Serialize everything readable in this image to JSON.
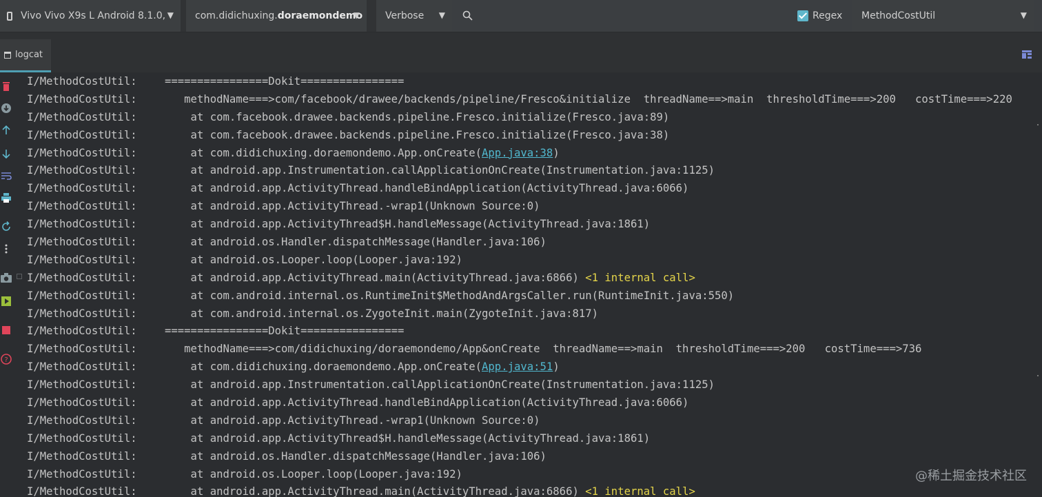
{
  "toolbar": {
    "device": "Vivo Vivo X9s L Android 8.1.0,",
    "process_prefix": "com.didichuxing.",
    "process_bold": "doraemondemo",
    "log_level": "Verbose",
    "regex_label": "Regex",
    "filter_value": "MethodCostUtil"
  },
  "tab": {
    "label": "logcat"
  },
  "log_lines": [
    {
      "tag": "I/MethodCostUtil:",
      "msg": "================Dokit================"
    },
    {
      "tag": "I/MethodCostUtil:",
      "msg": "   methodName===>com/facebook/drawee/backends/pipeline/Fresco&initialize  threadName==>main  thresholdTime===>200   costTime===>220"
    },
    {
      "tag": "I/MethodCostUtil:",
      "msg": "    at com.facebook.drawee.backends.pipeline.Fresco.initialize(Fresco.java:89)"
    },
    {
      "tag": "I/MethodCostUtil:",
      "msg": "    at com.facebook.drawee.backends.pipeline.Fresco.initialize(Fresco.java:38)"
    },
    {
      "tag": "I/MethodCostUtil:",
      "msg": "    at com.didichuxing.doraemondemo.App.onCreate(",
      "link": "App.java:38",
      "after": ")"
    },
    {
      "tag": "I/MethodCostUtil:",
      "msg": "    at android.app.Instrumentation.callApplicationOnCreate(Instrumentation.java:1125)"
    },
    {
      "tag": "I/MethodCostUtil:",
      "msg": "    at android.app.ActivityThread.handleBindApplication(ActivityThread.java:6066)"
    },
    {
      "tag": "I/MethodCostUtil:",
      "msg": "    at android.app.ActivityThread.-wrap1(Unknown Source:0)"
    },
    {
      "tag": "I/MethodCostUtil:",
      "msg": "    at android.app.ActivityThread$H.handleMessage(ActivityThread.java:1861)"
    },
    {
      "tag": "I/MethodCostUtil:",
      "msg": "    at android.os.Handler.dispatchMessage(Handler.java:106)"
    },
    {
      "tag": "I/MethodCostUtil:",
      "msg": "    at android.os.Looper.loop(Looper.java:192)"
    },
    {
      "tag": "I/MethodCostUtil:",
      "msg": "    at android.app.ActivityThread.main(ActivityThread.java:6866) ",
      "hint": "<1 internal call>"
    },
    {
      "tag": "I/MethodCostUtil:",
      "msg": "    at com.android.internal.os.RuntimeInit$MethodAndArgsCaller.run(RuntimeInit.java:550)"
    },
    {
      "tag": "I/MethodCostUtil:",
      "msg": "    at com.android.internal.os.ZygoteInit.main(ZygoteInit.java:817)"
    },
    {
      "tag": "I/MethodCostUtil:",
      "msg": "================Dokit================"
    },
    {
      "tag": "I/MethodCostUtil:",
      "msg": "   methodName===>com/didichuxing/doraemondemo/App&onCreate  threadName==>main  thresholdTime===>200   costTime===>736"
    },
    {
      "tag": "I/MethodCostUtil:",
      "msg": "    at com.didichuxing.doraemondemo.App.onCreate(",
      "link": "App.java:51",
      "after": ")"
    },
    {
      "tag": "I/MethodCostUtil:",
      "msg": "    at android.app.Instrumentation.callApplicationOnCreate(Instrumentation.java:1125)"
    },
    {
      "tag": "I/MethodCostUtil:",
      "msg": "    at android.app.ActivityThread.handleBindApplication(ActivityThread.java:6066)"
    },
    {
      "tag": "I/MethodCostUtil:",
      "msg": "    at android.app.ActivityThread.-wrap1(Unknown Source:0)"
    },
    {
      "tag": "I/MethodCostUtil:",
      "msg": "    at android.app.ActivityThread$H.handleMessage(ActivityThread.java:1861)"
    },
    {
      "tag": "I/MethodCostUtil:",
      "msg": "    at android.os.Handler.dispatchMessage(Handler.java:106)"
    },
    {
      "tag": "I/MethodCostUtil:",
      "msg": "    at android.os.Looper.loop(Looper.java:192)"
    },
    {
      "tag": "I/MethodCostUtil:",
      "msg": "    at android.app.ActivityThread.main(ActivityThread.java:6866) ",
      "hint": "<1 internal call>"
    }
  ],
  "watermark": "@稀土掘金技术社区",
  "colors": {
    "background": "#2b2d30",
    "link": "#51b8cf",
    "hint": "#e4d44a",
    "tab_underline": "#4e9fb3"
  }
}
